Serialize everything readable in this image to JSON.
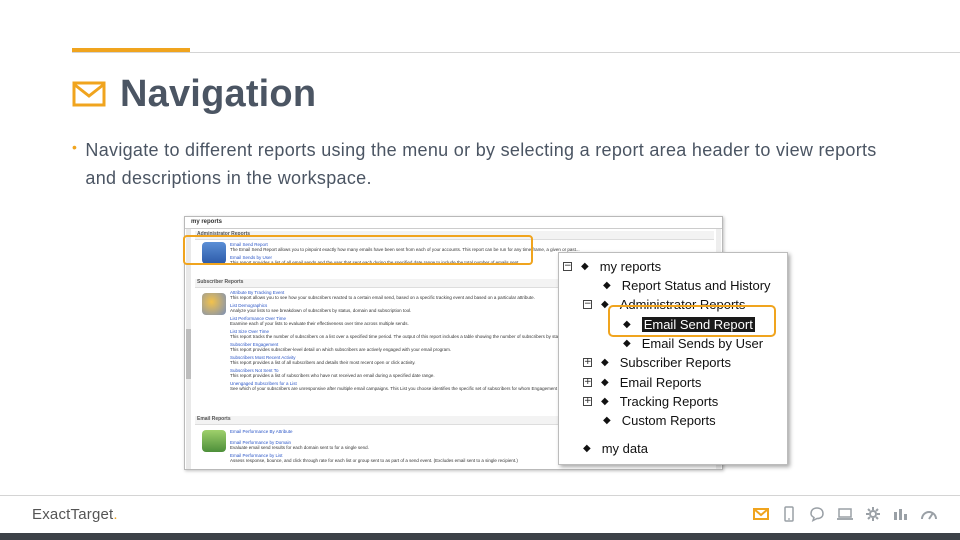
{
  "slide": {
    "title": "Navigation",
    "bullet": "Navigate to different reports using the menu or by selecting a report area header to view reports and descriptions in the workspace."
  },
  "screenshot": {
    "header": "my reports",
    "sections": [
      {
        "label": "Administrator Reports",
        "reports": [
          {
            "link": "Email Send Report",
            "desc": "The Email Send Report allows you to pinpoint exactly how many emails have been sent from each of your accounts. This report can be run for any time frame, a given or past..."
          },
          {
            "link": "Email Sends by User",
            "desc": "This report provides a list of all email sends and the user that sent each during the specified date range to include the total number of emails sent."
          }
        ]
      },
      {
        "label": "Subscriber Reports",
        "reports": [
          {
            "link": "Attribute By Tracking Event",
            "desc": "This report allows you to see how your subscribers reacted to a certain email send, based on a specific tracking event and based on a particular attribute."
          },
          {
            "link": "List Demographics",
            "desc": "Analyze your lists to see breakdown of subscribers by status, domain and subscription tool."
          },
          {
            "link": "List Performance Over Time",
            "desc": "Examine each of your lists to evaluate their effectiveness over time across multiple sends."
          },
          {
            "link": "List Size Over Time",
            "desc": "This report tracks the number of subscribers on a list over a specified time period. The output of this report includes a table showing the number of subscribers by status for each..."
          },
          {
            "link": "Subscriber Engagement",
            "desc": "This report provides subscriber-level detail on which subscribers are actively engaged with your email program."
          },
          {
            "link": "Subscribers Most Recent Activity",
            "desc": "This report provides a list of all subscribers and details their most recent open or click activity."
          },
          {
            "link": "Subscribers Not Sent To",
            "desc": "This report provides a list of subscribers who have not received an email during a specified date range."
          },
          {
            "link": "Unengaged Subscribers for a List",
            "desc": "See which of your subscribers are unresponsive after multiple email campaigns. This List you choose identifies the specific set of subscribers for whom Engagement will be se..."
          }
        ]
      },
      {
        "label": "Email Reports",
        "reports": [
          {
            "link": "Email Performance By Attribute",
            "desc": ""
          },
          {
            "link": "Email Performance by Domain",
            "desc": "Evaluate email send results for each domain sent to for a single send."
          },
          {
            "link": "Email Performance by List",
            "desc": "Assess response, bounce, and click through rate for each list or group sent to as part of a send event. (Excludes email sent to a single recipient.)"
          }
        ]
      }
    ]
  },
  "tree": {
    "root": "my reports",
    "items": [
      {
        "label": "Report Status and History",
        "expander": ""
      },
      {
        "label": "Administrator Reports",
        "expander": "−"
      },
      {
        "label": "Email Send Report",
        "expander": "",
        "selected": true
      },
      {
        "label": "Email Sends by User",
        "expander": ""
      },
      {
        "label": "Subscriber Reports",
        "expander": "+"
      },
      {
        "label": "Email Reports",
        "expander": "+"
      },
      {
        "label": "Tracking Reports",
        "expander": "+"
      },
      {
        "label": "Custom Reports",
        "expander": ""
      }
    ],
    "data_root": "my data"
  },
  "footer": {
    "brand": "ExactTarget",
    "brand_suffix": ".",
    "icons": [
      "email-icon",
      "mobile-icon",
      "chat-icon",
      "laptop-icon",
      "gear-icon",
      "bar-chart-icon",
      "gauge-icon"
    ]
  },
  "colors": {
    "accent": "#f0a41e",
    "title": "#4b5563",
    "bottom_bar": "#3c4148"
  }
}
